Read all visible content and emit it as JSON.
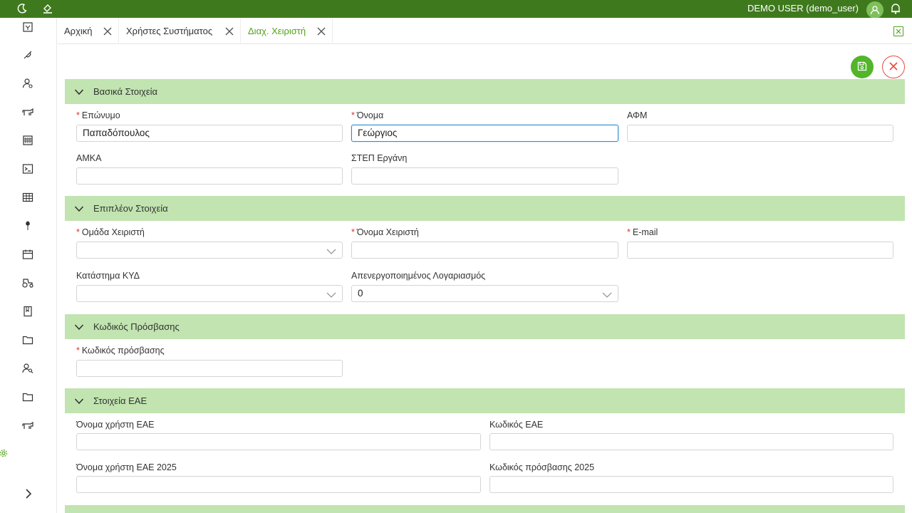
{
  "topbar": {
    "user_label": "DEMO USER (demo_user)",
    "icons": [
      "moon-icon",
      "paint-bucket-icon",
      "avatar-icon",
      "bell-icon"
    ],
    "bg_color": "#3e7a1d"
  },
  "sidebar": {
    "items": [
      "register-icon",
      "feather-icon",
      "user-search-icon",
      "livestock-icon",
      "building-icon",
      "terminal-icon",
      "table-icon",
      "plant-icon",
      "calendar-icon",
      "tractor-icon",
      "book-icon",
      "folder-icon",
      "users-search-icon",
      "folder-icon",
      "animal-icon"
    ],
    "extra_icons": [
      "gear-icon",
      "chevron-right-icon"
    ]
  },
  "tabs": [
    {
      "label": "Αρχική",
      "active": false
    },
    {
      "label": "Χρήστες Συστήματος",
      "active": false
    },
    {
      "label": "Διαχ. Χειριστή",
      "active": true
    }
  ],
  "actions": {
    "save_icon": "save-icon",
    "close_icon": "close-icon"
  },
  "sections": {
    "basic": {
      "title": "Βασικά Στοιχεία",
      "fields": {
        "surname": {
          "label": "Επώνυμο",
          "required": true,
          "value": "Παπαδόπουλος"
        },
        "name": {
          "label": "Όνομα",
          "required": true,
          "value": "Γεώργιος"
        },
        "afm": {
          "label": "ΑΦΜ",
          "required": false,
          "value": ""
        },
        "amka": {
          "label": "ΑΜΚΑ",
          "required": false,
          "value": ""
        },
        "step": {
          "label": "ΣΤΕΠ Εργάνη",
          "required": false,
          "value": ""
        }
      }
    },
    "extra": {
      "title": "Επιπλέον Στοιχεία",
      "fields": {
        "group": {
          "label": "Ομάδα Χειριστή",
          "required": true,
          "value": ""
        },
        "username": {
          "label": "Όνομα Χειριστή",
          "required": true,
          "value": ""
        },
        "email": {
          "label": "E-mail",
          "required": true,
          "value": ""
        },
        "store": {
          "label": "Κατάστημα ΚΥΔ",
          "required": false,
          "value": ""
        },
        "disabled": {
          "label": "Απενεργοποιημένος Λογαριασμός",
          "required": false,
          "value": "0"
        }
      }
    },
    "password": {
      "title": "Κωδικός Πρόσβασης",
      "fields": {
        "password": {
          "label": "Κωδικός πρόσβασης",
          "required": true,
          "value": ""
        }
      }
    },
    "eae": {
      "title": "Στοιχεία ΕΑΕ",
      "fields": {
        "eae_user": {
          "label": "Όνομα χρήστη ΕΑΕ",
          "value": ""
        },
        "eae_code": {
          "label": "Κωδικός ΕΑΕ",
          "value": ""
        },
        "eae_user_2025": {
          "label": "Όνομα χρήστη ΕΑΕ 2025",
          "value": ""
        },
        "eae_pass_2025": {
          "label": "Κωδικός πρόσβασης 2025",
          "value": ""
        }
      }
    }
  },
  "required_marker": "*",
  "colors": {
    "accent": "#52a21c",
    "section_bg": "#c1e4b0",
    "required": "#e03030",
    "focus": "#2e8fd6"
  }
}
